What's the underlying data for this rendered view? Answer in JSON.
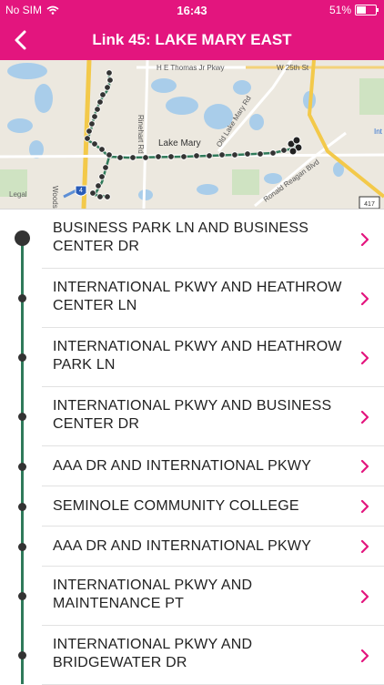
{
  "status_bar": {
    "carrier": "No SIM",
    "time": "16:43",
    "battery": "51%",
    "battery_level": 0.51
  },
  "header": {
    "title": "Link 45: LAKE MARY EAST"
  },
  "map": {
    "labels": {
      "thomas": "H E Thomas Jr Pkwy",
      "w25": "W 25th St",
      "rinehart": "Rinehart Rd",
      "oldlakemary": "Old Lake Mary Rd",
      "lakemary": "Lake Mary",
      "ronald": "Ronald Reagan Blvd",
      "woods": "Woods Rd",
      "legal": "Legal",
      "shield": "4",
      "partial_right": "Int",
      "partial_shield": "417"
    }
  },
  "stops": [
    {
      "name": "BUSINESS PARK LN AND BUSINESS CENTER DR"
    },
    {
      "name": "INTERNATIONAL PKWY AND HEATHROW CENTER LN"
    },
    {
      "name": "INTERNATIONAL PKWY AND HEATHROW PARK LN"
    },
    {
      "name": "INTERNATIONAL PKWY AND BUSINESS CENTER DR"
    },
    {
      "name": "AAA DR AND INTERNATIONAL PKWY"
    },
    {
      "name": "SEMINOLE COMMUNITY COLLEGE"
    },
    {
      "name": "AAA DR AND INTERNATIONAL PKWY"
    },
    {
      "name": "INTERNATIONAL PKWY AND MAINTENANCE PT"
    },
    {
      "name": "INTERNATIONAL PKWY AND BRIDGEWATER DR"
    }
  ],
  "colors": {
    "accent": "#e3157e",
    "route_line": "#2f7a5a",
    "stop_dot": "#333333"
  },
  "icons": {
    "back": "chevron-left-icon",
    "row": "chevron-right-icon",
    "wifi": "wifi-icon",
    "battery": "battery-icon"
  }
}
